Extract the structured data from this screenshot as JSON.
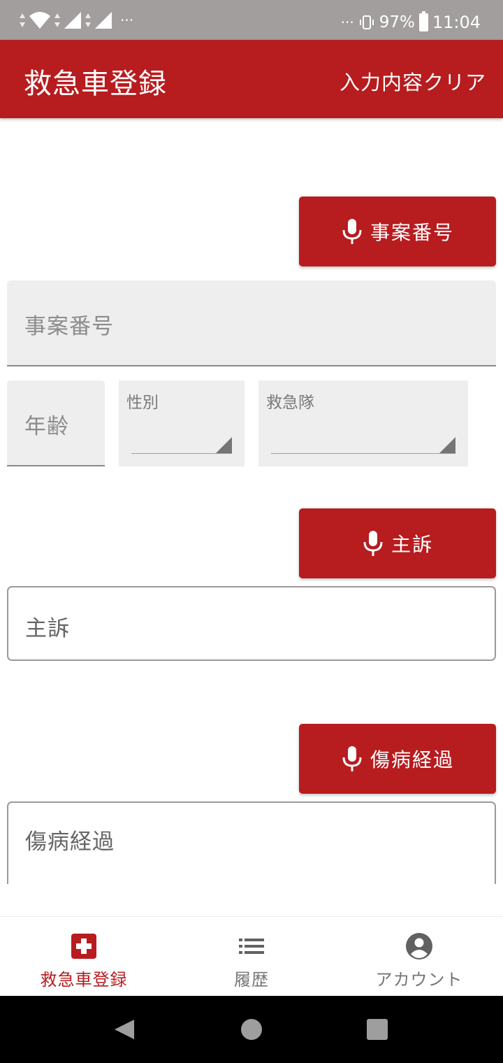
{
  "status_bar": {
    "dots_left": "···",
    "dots_right": "···",
    "battery_percent": "97%",
    "time": "11:04"
  },
  "app_bar": {
    "title": "救急車登録",
    "clear_label": "入力内容クリア"
  },
  "form": {
    "case_number_button": "事案番号",
    "case_number_placeholder": "事案番号",
    "age_placeholder": "年齢",
    "gender_label": "性別",
    "team_label": "救急隊",
    "complaint_button": "主訴",
    "complaint_placeholder": "主訴",
    "history_button": "傷病経過",
    "history_placeholder": "傷病経過"
  },
  "bottom_nav": {
    "items": [
      {
        "label": "救急車登録",
        "icon": "hospital-cross-icon",
        "active": true
      },
      {
        "label": "履歴",
        "icon": "list-icon",
        "active": false
      },
      {
        "label": "アカウント",
        "icon": "account-circle-icon",
        "active": false
      }
    ]
  },
  "colors": {
    "primary": "#b71c1f",
    "status_bar": "#a29e9e",
    "field_fill": "#eeeeee"
  }
}
